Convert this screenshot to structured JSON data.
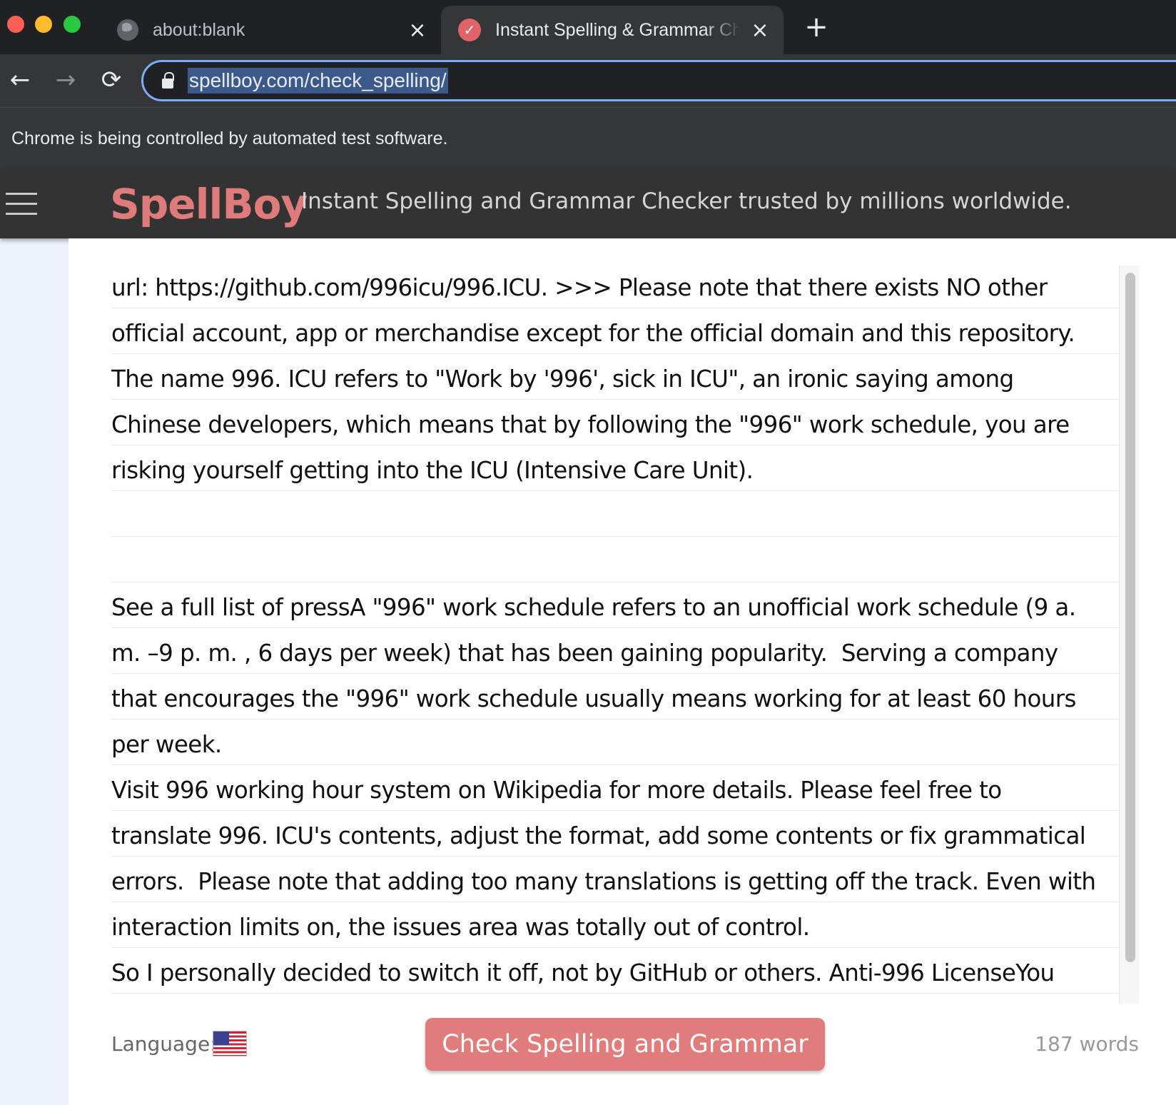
{
  "browser": {
    "tabs": [
      {
        "title": "about:blank",
        "close": "×"
      },
      {
        "title": "Instant Spelling & Grammar Checker",
        "close": "×"
      }
    ],
    "new_tab": "+",
    "nav": {
      "back": "←",
      "forward": "→",
      "reload": "⟳"
    },
    "url": "spellboy.com/check_spelling/",
    "infobar": "Chrome is being controlled by automated test software."
  },
  "site": {
    "logo": "SpellBoy",
    "tagline": "Instant Spelling and Grammar Checker trusted by millions worldwide.",
    "brand_color": "#e07b7b"
  },
  "editor": {
    "lines": [
      "url: https://github.com/996icu/996.ICU. >>> Please note that there exists NO other",
      "official account, app or merchandise except for the official domain and this repository.",
      "The name 996. ICU refers to \"Work by '996', sick in ICU\", an ironic saying among",
      "Chinese developers, which means that by following the \"996\" work schedule, you are",
      "risking yourself getting into the ICU (Intensive Care Unit).",
      "",
      "",
      "See a full list of pressA \"996\" work schedule refers to an unofficial work schedule (9 a.",
      "m. –9 p. m. , 6 days per week) that has been gaining popularity.  Serving a company",
      "that encourages the \"996\" work schedule usually means working for at least 60 hours",
      "per week.",
      "Visit 996 working hour system on Wikipedia for more details. Please feel free to",
      "translate 996. ICU's contents, adjust the format, add some contents or fix grammatical",
      "errors.  Please note that adding too many translations is getting off the track. Even with",
      "interaction limits on, the issues area was totally out of control.",
      "So I personally decided to switch it off, not by GitHub or others. Anti-996 LicenseYou"
    ]
  },
  "footer": {
    "language_label": "Language:",
    "language_flag": "us-flag-icon",
    "check_button": "Check Spelling and Grammar",
    "word_count": "187 words"
  }
}
